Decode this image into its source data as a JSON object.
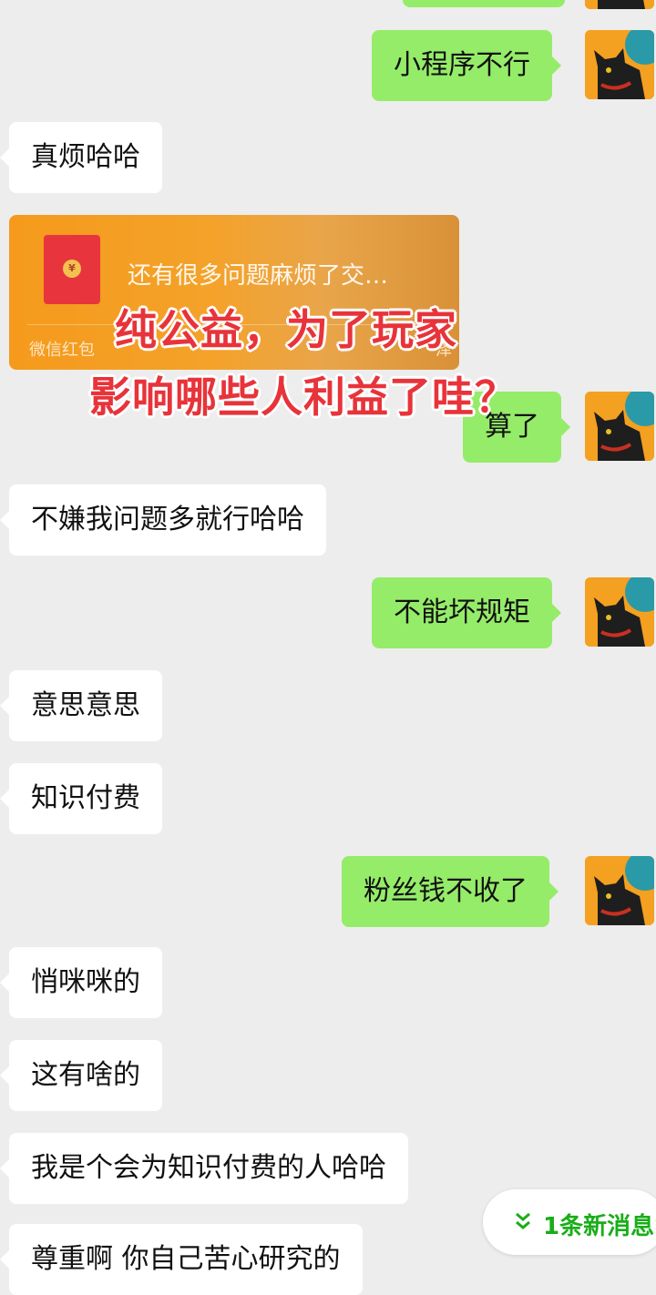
{
  "messages": [
    {
      "side": "right",
      "text": "小程序不行"
    },
    {
      "side": "left",
      "text": "真烦哈哈"
    },
    {
      "side": "right",
      "text": "算了"
    },
    {
      "side": "left",
      "text": "不嫌我问题多就行哈哈"
    },
    {
      "side": "right",
      "text": "不能坏规矩"
    },
    {
      "side": "left",
      "text": "意思意思"
    },
    {
      "side": "left",
      "text": "知识付费"
    },
    {
      "side": "right",
      "text": "粉丝钱不收了"
    },
    {
      "side": "left",
      "text": "悄咪咪的"
    },
    {
      "side": "left",
      "text": "这有啥的"
    },
    {
      "side": "left",
      "text": "我是个会为知识付费的人哈哈"
    },
    {
      "side": "left",
      "text": "尊重啊 你自己苦心研究的"
    }
  ],
  "red_packet": {
    "message": "还有很多问题麻烦了交…",
    "label": "微信红包",
    "corner_text": "泽",
    "envelope_color": "#e8353d"
  },
  "overlay": {
    "line1": "纯公益，为了玩家",
    "line2": "影响哪些人利益了哇？",
    "color": "#e8333a"
  },
  "new_messages": {
    "text": "1条新消息",
    "icon": "double-chevron-down-icon"
  },
  "colors": {
    "background": "#ededed",
    "own_bubble": "#95ec69",
    "other_bubble": "#ffffff",
    "accent_green": "#1aad19"
  }
}
